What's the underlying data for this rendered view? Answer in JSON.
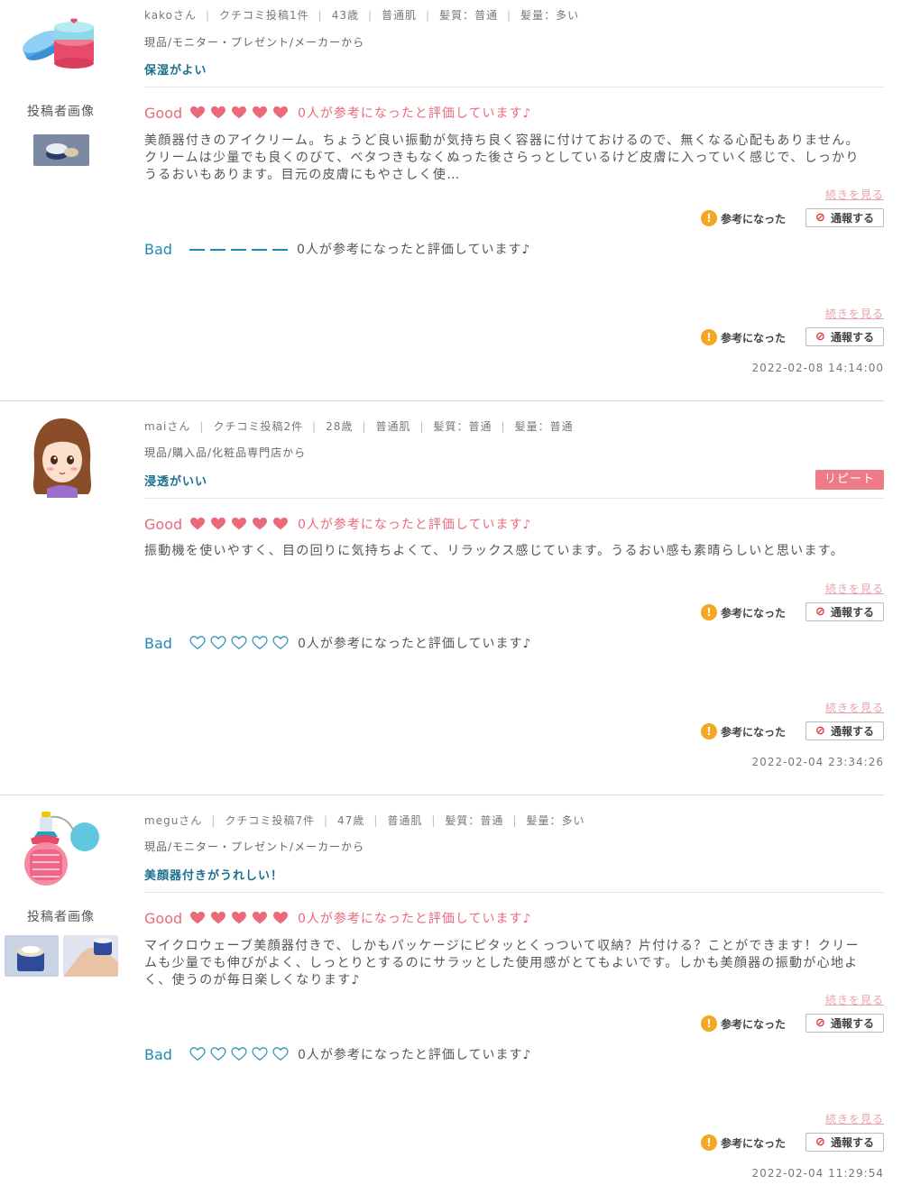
{
  "reviews": [
    {
      "user": "kakoさん",
      "posts": "クチコミ投稿1件",
      "age": "43歳",
      "skin": "普通肌",
      "hair": "髪質：普通",
      "volume": "髪量：多い",
      "source": "現品/モニター・プレゼント/メーカーから",
      "headline": "保湿がよい",
      "photo_title": "投稿者画像",
      "good_label": "Good",
      "good_count": "0人が参考になったと評価しています♪",
      "good_text": "美顔器付きのアイクリーム。ちょうど良い振動が気持ち良く容器に付けておけるので、無くなる心配もありません。クリームは少量でも良くのびて、ベタつきもなくぬった後さらっとしているけど皮膚に入っていく感じで、しっかりうるおいもあります。目元の皮膚にもやさしく使…",
      "more_label": "続きを見る",
      "helpful_label": "参考になった",
      "report_label": "通報する",
      "bad_label": "Bad",
      "bad_count": "0人が参考になったと評価しています♪",
      "date": "2022-02-08 14:14:00",
      "good_hearts": 5,
      "bad_style": "dash"
    },
    {
      "user": "maiさん",
      "posts": "クチコミ投稿2件",
      "age": "28歳",
      "skin": "普通肌",
      "hair": "髪質：普通",
      "volume": "髪量：普通",
      "source": "現品/購入品/化粧品専門店から",
      "headline": "浸透がいい",
      "repeat_label": "リピート",
      "good_label": "Good",
      "good_count": "0人が参考になったと評価しています♪",
      "good_text": "振動機を使いやすく、目の回りに気持ちよくて、リラックス感じています。うるおい感も素晴らしいと思います。",
      "more_label": "続きを見る",
      "helpful_label": "参考になった",
      "report_label": "通報する",
      "bad_label": "Bad",
      "bad_count": "0人が参考になったと評価しています♪",
      "date": "2022-02-04 23:34:26",
      "good_hearts": 5,
      "bad_style": "hearts"
    },
    {
      "user": "meguさん",
      "posts": "クチコミ投稿7件",
      "age": "47歳",
      "skin": "普通肌",
      "hair": "髪質：普通",
      "volume": "髪量：多い",
      "source": "現品/モニター・プレゼント/メーカーから",
      "headline": "美顔器付きがうれしい！",
      "photo_title": "投稿者画像",
      "good_label": "Good",
      "good_count": "0人が参考になったと評価しています♪",
      "good_text": "マイクロウェーブ美顔器付きで、しかもパッケージにピタッとくっついて収納？片付ける？ことができます！クリームも少量でも伸びがよく、しっとりとするのにサラッとした使用感がとてもよいです。しかも美顔器の振動が心地よく、使うのが毎日楽しくなります♪",
      "more_label": "続きを見る",
      "helpful_label": "参考になった",
      "report_label": "通報する",
      "bad_label": "Bad",
      "bad_count": "0人が参考になったと評価しています♪",
      "date": "2022-02-04 11:29:54",
      "good_hearts": 5,
      "bad_style": "hearts"
    }
  ],
  "colors": {
    "good": "#ea6a7a",
    "bad": "#1f8ab3",
    "headline": "#1a6f8e",
    "repeat_badge": "#ef7b86",
    "helpful_icon": "#f5a623"
  }
}
